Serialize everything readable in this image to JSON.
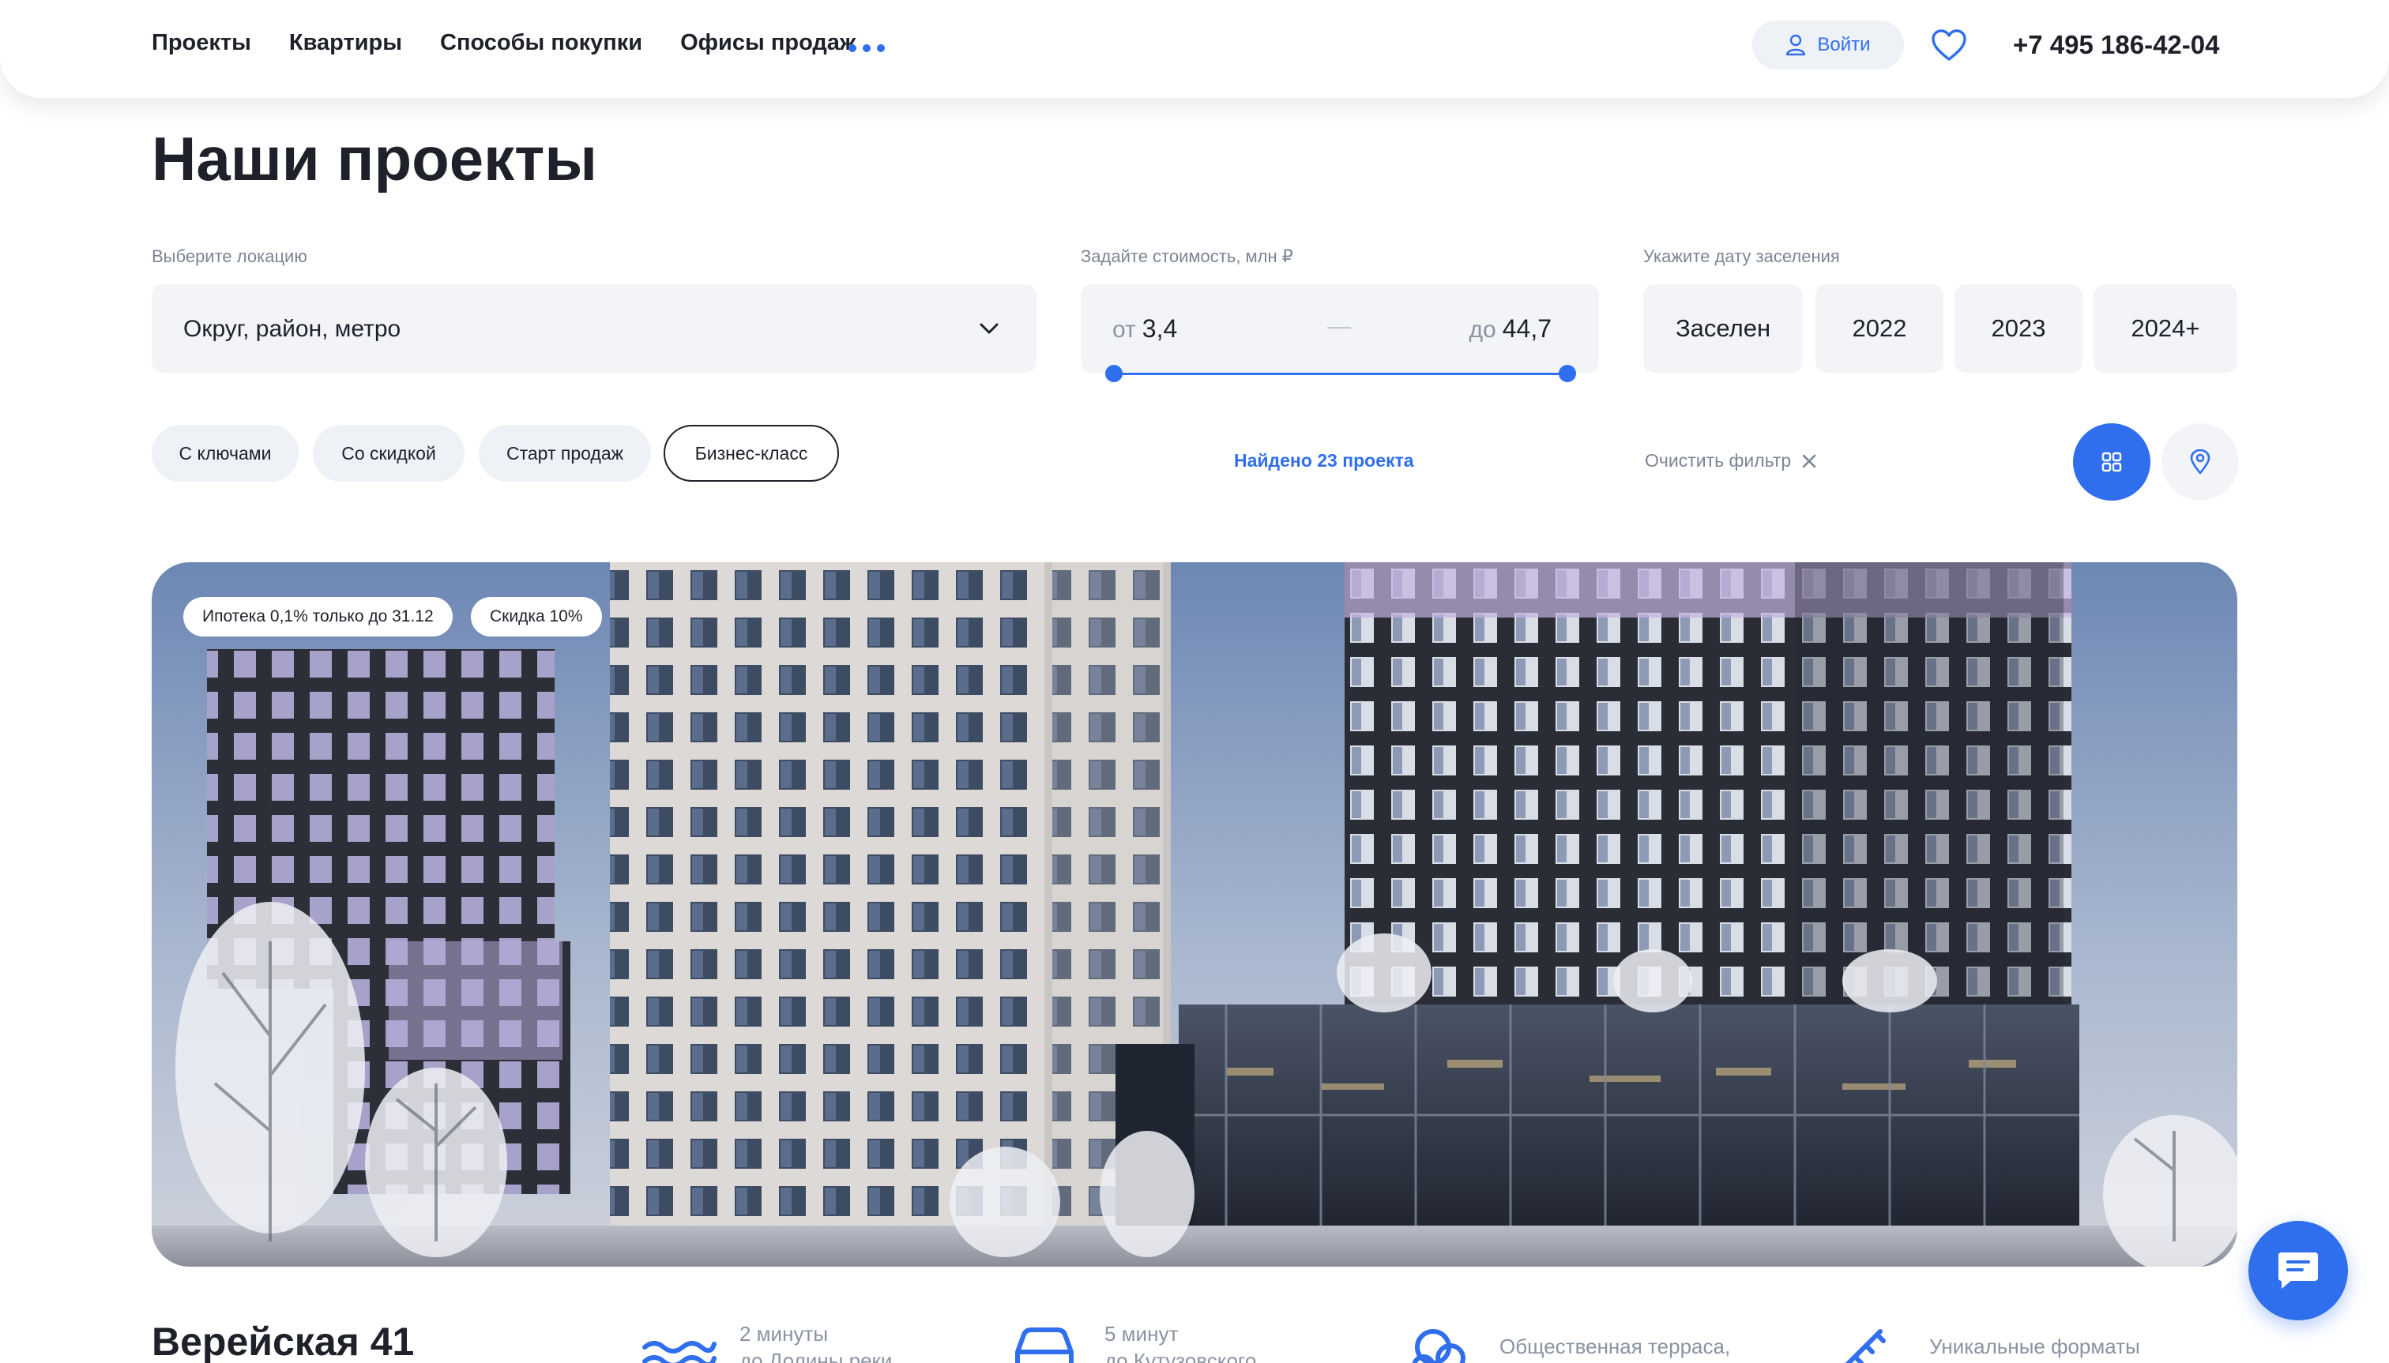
{
  "colors": {
    "accent": "#2f6fed",
    "text": "#1e2129",
    "muted": "#7c8594",
    "field_bg": "#f2f4f7"
  },
  "nav": {
    "items": [
      "Проекты",
      "Квартиры",
      "Способы покупки",
      "Офисы продаж"
    ],
    "more_icon": "more-dots-icon"
  },
  "header": {
    "login_label": "Войти",
    "login_icon": "user-icon",
    "favorites_icon": "heart-icon",
    "phone": "+7 495 186-42-04"
  },
  "page": {
    "title": "Наши проекты"
  },
  "filters": {
    "location": {
      "label": "Выберите локацию",
      "placeholder": "Округ, район, метро",
      "icon": "chevron-down-icon"
    },
    "price": {
      "label": "Задайте стоимость, млн ₽",
      "from_prefix": "от",
      "from_value": "3,4",
      "to_prefix": "до",
      "to_value": "44,7"
    },
    "date": {
      "label": "Укажите дату заселения",
      "options": [
        "Заселен",
        "2022",
        "2023",
        "2024+"
      ]
    },
    "chips": [
      "С ключами",
      "Со скидкой",
      "Старт продаж",
      "Бизнес-класс"
    ],
    "active_chip": "Бизнес-класс",
    "found_text": "Найдено 23 проекта",
    "clear_text": "Очистить фильтр",
    "view_modes": [
      "grid-icon",
      "map-pin-icon"
    ],
    "active_view": "grid-icon"
  },
  "project": {
    "badges": [
      "Ипотека 0,1% только до 31.12",
      "Скидка 10%"
    ],
    "name": "Верейская 41",
    "features": [
      {
        "icon": "waves-icon",
        "line1": "2 минуты",
        "line2": "до Долины реки"
      },
      {
        "icon": "car-icon",
        "line1": "5 минут",
        "line2": "до Кутузовского"
      },
      {
        "icon": "cloud-icon",
        "line1": "Общественная терраса,",
        "line2": ""
      },
      {
        "icon": "ruler-icon",
        "line1": "Уникальные форматы",
        "line2": ""
      }
    ]
  },
  "chat": {
    "icon": "chat-icon"
  }
}
